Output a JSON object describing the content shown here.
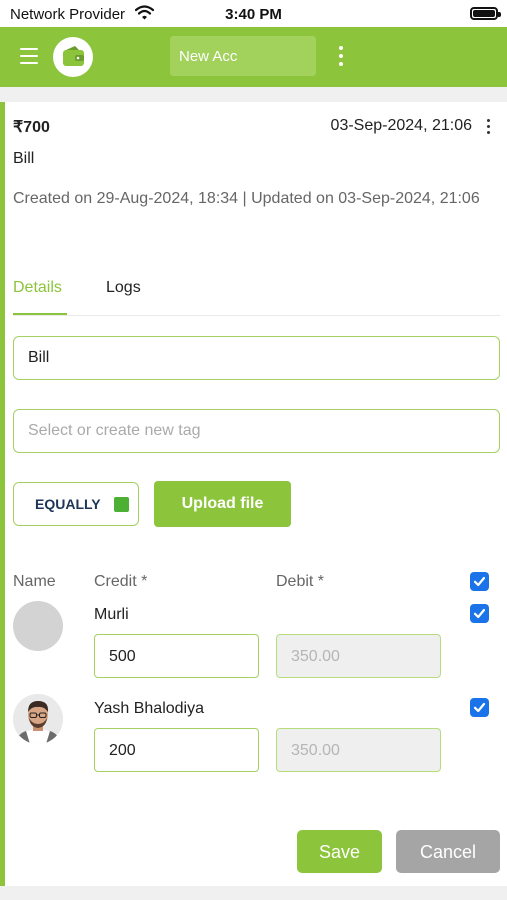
{
  "status_bar": {
    "carrier": "Network Provider",
    "time": "3:40 PM",
    "icons": [
      "wifi-icon",
      "battery-icon"
    ]
  },
  "header": {
    "account_name": "New Acc",
    "menu_icon": "hamburger-menu-icon",
    "logo_icon": "wallet-icon",
    "more_icon": "vertical-more-icon"
  },
  "transaction": {
    "amount": "₹700",
    "date": "03-Sep-2024, 21:06",
    "title": "Bill",
    "meta": "Created on 29-Aug-2024, 18:34 | Updated on 03-Sep-2024, 21:06"
  },
  "tabs": [
    {
      "label": "Details",
      "active": true
    },
    {
      "label": "Logs",
      "active": false
    }
  ],
  "form": {
    "name_value": "Bill",
    "tag_placeholder": "Select or create new tag",
    "split_mode": "EQUALLY",
    "split_checked": true,
    "upload_label": "Upload file"
  },
  "table": {
    "headers": {
      "name": "Name",
      "credit": "Credit *",
      "debit": "Debit *"
    },
    "select_all_checked": true,
    "rows": [
      {
        "name": "Murli",
        "credit": "500",
        "debit": "350.00",
        "checked": true,
        "avatar": "placeholder"
      },
      {
        "name": "Yash Bhalodiya",
        "credit": "200",
        "debit": "350.00",
        "checked": true,
        "avatar": "photo"
      }
    ]
  },
  "actions": {
    "save_label": "Save",
    "cancel_label": "Cancel"
  },
  "colors": {
    "primary": "#8cc43c",
    "checkbox": "#1a73e8",
    "equally_box": "#4cb035",
    "cancel": "#a5a5a5"
  }
}
